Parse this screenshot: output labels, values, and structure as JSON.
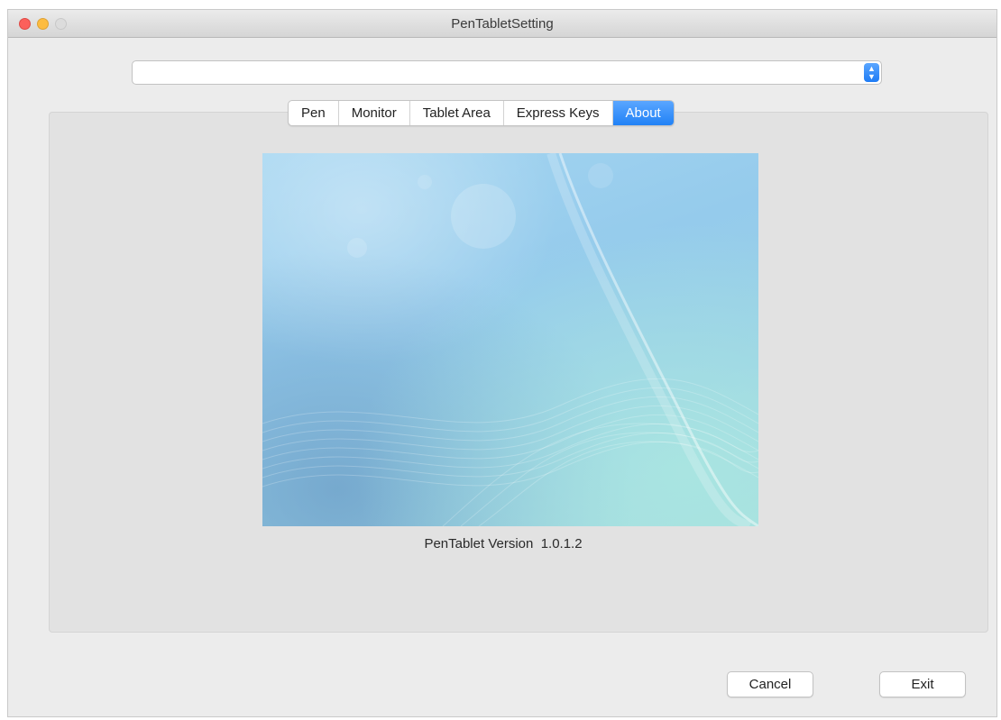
{
  "window": {
    "title": "PenTabletSetting"
  },
  "device_select": {
    "value": "",
    "icon": "updown-chevron-icon"
  },
  "tabs": [
    {
      "label": "Pen",
      "active": false
    },
    {
      "label": "Monitor",
      "active": false
    },
    {
      "label": "Tablet Area",
      "active": false
    },
    {
      "label": "Express Keys",
      "active": false
    },
    {
      "label": "About",
      "active": true
    }
  ],
  "about": {
    "version_text": "PenTablet Version  1.0.1.2"
  },
  "buttons": {
    "cancel_label": "Cancel",
    "exit_label": "Exit"
  },
  "colors": {
    "accent": "#2182f6",
    "close": "#fc605b",
    "minimize": "#fdbc40",
    "zoom_disabled": "#dcdcdc"
  }
}
